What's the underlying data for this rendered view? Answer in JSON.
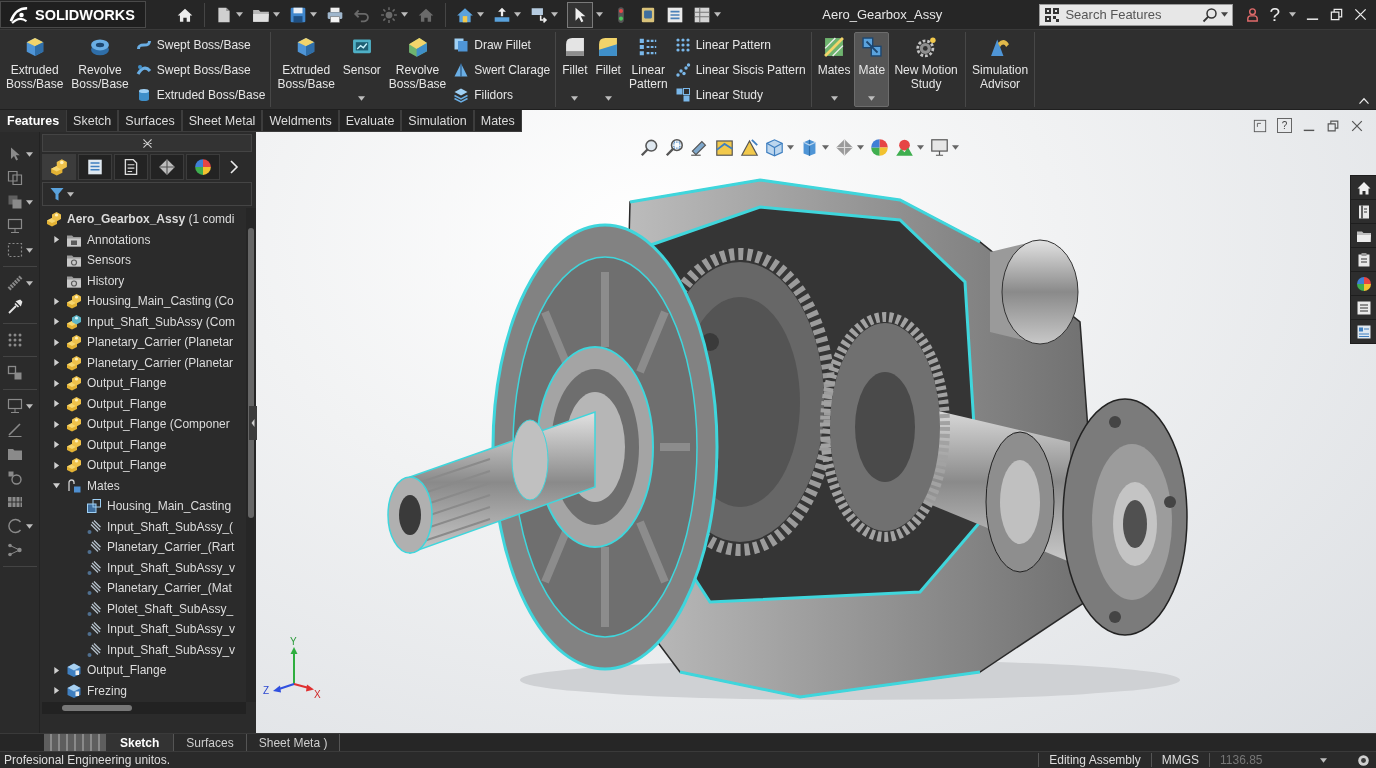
{
  "app_bar": {
    "logo": "SOLIDWORKS",
    "select_tool": {
      "selected": true
    },
    "title": "Aero_Gearbox_Assy",
    "search": {
      "placeholder": "Search Features"
    },
    "help": "?"
  },
  "ribbon": {
    "groups": [
      {
        "large": [
          {
            "label": "Extruded Boss/Base",
            "dropdown": false,
            "selected": false
          },
          {
            "label": "Revolve Boss/Base",
            "dropdown": false,
            "selected": false
          }
        ],
        "small": [
          "Swept Boss/Base",
          "Swept Boss/Base",
          "Extruded Boss/Base"
        ]
      },
      {
        "large": [
          {
            "label": "Extruded Boss/Base",
            "dropdown": false,
            "selected": false
          },
          {
            "label": "Sensor",
            "dropdown": true,
            "selected": false
          },
          {
            "label": "Revolve Boss/Base",
            "dropdown": false,
            "selected": false
          }
        ],
        "small": [
          "Draw Fillet",
          "Swert Clarage",
          "Filidors"
        ]
      },
      {
        "large": [
          {
            "label": "Fillet",
            "dropdown": true,
            "selected": false
          },
          {
            "label": "Fillet",
            "dropdown": true,
            "selected": false
          },
          {
            "label": "Linear Pattern",
            "dropdown": false,
            "selected": false
          }
        ],
        "small": [
          "Linear Pattern",
          "Linear Siscis Pattern",
          "Linear Study"
        ]
      },
      {
        "large": [
          {
            "label": "Mates",
            "dropdown": true,
            "selected": false
          },
          {
            "label": "Mate",
            "dropdown": true,
            "selected": true
          },
          {
            "label": "New Motion Study",
            "dropdown": false,
            "selected": false
          }
        ]
      },
      {
        "large": [
          {
            "label": "Simulation Advisor",
            "dropdown": false,
            "selected": false
          }
        ]
      }
    ]
  },
  "command_tabs": [
    {
      "label": "Features",
      "selected": true
    },
    {
      "label": "Sketch",
      "selected": false
    },
    {
      "label": "Surfaces",
      "selected": false
    },
    {
      "label": "Sheet Metal",
      "selected": false
    },
    {
      "label": "Weldments",
      "selected": false
    },
    {
      "label": "Evaluate",
      "selected": false
    },
    {
      "label": "Simulation",
      "selected": false
    },
    {
      "label": "Mates",
      "selected": false
    }
  ],
  "panel_tabs": [
    {
      "selected": true
    },
    {
      "selected": false
    },
    {
      "selected": false
    },
    {
      "selected": false
    },
    {
      "selected": false
    }
  ],
  "feature_tree": {
    "root": {
      "label": "**Aero_Gearbox_Assy** (1 comdi",
      "kind": "assembly",
      "children": [
        {
          "label": "Annotations",
          "kind": "annotation_folder",
          "expanded": false
        },
        {
          "label": "Sensors",
          "kind": "sensor_folder"
        },
        {
          "label": "History",
          "kind": "history_folder"
        },
        {
          "label": "Housing_Main_Casting (Co",
          "kind": "assembly",
          "expanded": false
        },
        {
          "label": "Input_Shaft_SubAssy (Com",
          "kind": "subassembly",
          "expanded": false
        },
        {
          "label": "Planetary_Carrier (Planetar",
          "kind": "assembly",
          "expanded": false
        },
        {
          "label": "Planetary_Carrier (Planetar",
          "kind": "assembly",
          "expanded": false
        },
        {
          "label": "Output_Flange",
          "kind": "assembly",
          "expanded": false
        },
        {
          "label": "Output_Flange",
          "kind": "assembly",
          "expanded": false
        },
        {
          "label": "Output_Flange (Componer",
          "kind": "assembly",
          "expanded": false
        },
        {
          "label": "Output_Flange",
          "kind": "assembly",
          "expanded": false
        },
        {
          "label": "Output_Flange",
          "kind": "assembly",
          "expanded": false
        },
        {
          "label": "Mates",
          "kind": "mates_folder",
          "expanded": true,
          "children": [
            {
              "label": "Housing_Main_Casting",
              "kind": "mate_coincident"
            },
            {
              "label": "Input_Shaft_SubAssy_(",
              "kind": "mate_concentric"
            },
            {
              "label": "Planetary_Carrier_(Rart",
              "kind": "mate_concentric"
            },
            {
              "label": "Input_Shaft_SubAssy_v",
              "kind": "mate_concentric"
            },
            {
              "label": "Planetary_Carrier_(Mat",
              "kind": "mate_concentric"
            },
            {
              "label": "Plotet_Shaft_SubAssy_",
              "kind": "mate_concentric"
            },
            {
              "label": "Input_Shaft_SubAssy_v",
              "kind": "mate_concentric"
            },
            {
              "label": "Input_Shaft_SubAssy_v",
              "kind": "mate_concentric"
            }
          ]
        },
        {
          "label": "Output_Flange",
          "kind": "part",
          "expanded": false
        },
        {
          "label": "Frezing",
          "kind": "part",
          "expanded": false
        }
      ]
    }
  },
  "viewport": {
    "help": "?",
    "triad": {
      "x": "X",
      "y": "Y",
      "z": "Z"
    }
  },
  "bottom_tabs": [
    {
      "label": "Sketch",
      "selected": true
    },
    {
      "label": "Surfaces",
      "selected": false
    },
    {
      "label": "Sheet Meta )",
      "selected": false
    }
  ],
  "status_bar": {
    "message": "Profesional Engineering unitos.",
    "mode": "Editing Assembly",
    "units": "MMGS",
    "value": "1136.85"
  }
}
